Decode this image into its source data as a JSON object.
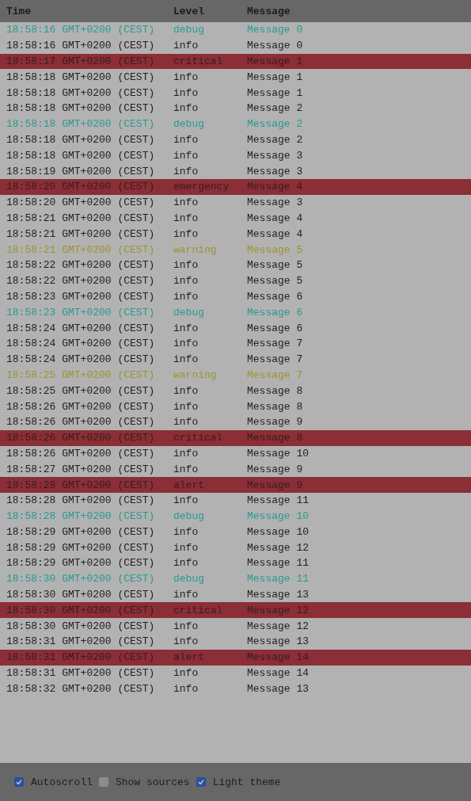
{
  "table": {
    "columns": [
      "Time",
      "Level",
      "Message"
    ],
    "rows": [
      {
        "time": "18:58:16 GMT+0200 (CEST)",
        "level": "debug",
        "message": "Message 0",
        "kind": "debug"
      },
      {
        "time": "18:58:16 GMT+0200 (CEST)",
        "level": "info",
        "message": "Message 0",
        "kind": "info"
      },
      {
        "time": "18:58:17 GMT+0200 (CEST)",
        "level": "critical",
        "message": "Message 1",
        "kind": "error"
      },
      {
        "time": "18:58:18 GMT+0200 (CEST)",
        "level": "info",
        "message": "Message 1",
        "kind": "info"
      },
      {
        "time": "18:58:18 GMT+0200 (CEST)",
        "level": "info",
        "message": "Message 1",
        "kind": "info"
      },
      {
        "time": "18:58:18 GMT+0200 (CEST)",
        "level": "info",
        "message": "Message 2",
        "kind": "info"
      },
      {
        "time": "18:58:18 GMT+0200 (CEST)",
        "level": "debug",
        "message": "Message 2",
        "kind": "debug"
      },
      {
        "time": "18:58:18 GMT+0200 (CEST)",
        "level": "info",
        "message": "Message 2",
        "kind": "info"
      },
      {
        "time": "18:58:18 GMT+0200 (CEST)",
        "level": "info",
        "message": "Message 3",
        "kind": "info"
      },
      {
        "time": "18:58:19 GMT+0200 (CEST)",
        "level": "info",
        "message": "Message 3",
        "kind": "info"
      },
      {
        "time": "18:58:20 GMT+0200 (CEST)",
        "level": "emergency",
        "message": "Message 4",
        "kind": "error"
      },
      {
        "time": "18:58:20 GMT+0200 (CEST)",
        "level": "info",
        "message": "Message 3",
        "kind": "info"
      },
      {
        "time": "18:58:21 GMT+0200 (CEST)",
        "level": "info",
        "message": "Message 4",
        "kind": "info"
      },
      {
        "time": "18:58:21 GMT+0200 (CEST)",
        "level": "info",
        "message": "Message 4",
        "kind": "info"
      },
      {
        "time": "18:58:21 GMT+0200 (CEST)",
        "level": "warning",
        "message": "Message 5",
        "kind": "warning"
      },
      {
        "time": "18:58:22 GMT+0200 (CEST)",
        "level": "info",
        "message": "Message 5",
        "kind": "info"
      },
      {
        "time": "18:58:22 GMT+0200 (CEST)",
        "level": "info",
        "message": "Message 5",
        "kind": "info"
      },
      {
        "time": "18:58:23 GMT+0200 (CEST)",
        "level": "info",
        "message": "Message 6",
        "kind": "info"
      },
      {
        "time": "18:58:23 GMT+0200 (CEST)",
        "level": "debug",
        "message": "Message 6",
        "kind": "debug"
      },
      {
        "time": "18:58:24 GMT+0200 (CEST)",
        "level": "info",
        "message": "Message 6",
        "kind": "info"
      },
      {
        "time": "18:58:24 GMT+0200 (CEST)",
        "level": "info",
        "message": "Message 7",
        "kind": "info"
      },
      {
        "time": "18:58:24 GMT+0200 (CEST)",
        "level": "info",
        "message": "Message 7",
        "kind": "info"
      },
      {
        "time": "18:58:25 GMT+0200 (CEST)",
        "level": "warning",
        "message": "Message 7",
        "kind": "warning"
      },
      {
        "time": "18:58:25 GMT+0200 (CEST)",
        "level": "info",
        "message": "Message 8",
        "kind": "info"
      },
      {
        "time": "18:58:26 GMT+0200 (CEST)",
        "level": "info",
        "message": "Message 8",
        "kind": "info"
      },
      {
        "time": "18:58:26 GMT+0200 (CEST)",
        "level": "info",
        "message": "Message 9",
        "kind": "info"
      },
      {
        "time": "18:58:26 GMT+0200 (CEST)",
        "level": "critical",
        "message": "Message 8",
        "kind": "error"
      },
      {
        "time": "18:58:26 GMT+0200 (CEST)",
        "level": "info",
        "message": "Message 10",
        "kind": "info"
      },
      {
        "time": "18:58:27 GMT+0200 (CEST)",
        "level": "info",
        "message": "Message 9",
        "kind": "info"
      },
      {
        "time": "18:58:28 GMT+0200 (CEST)",
        "level": "alert",
        "message": "Message 9",
        "kind": "error"
      },
      {
        "time": "18:58:28 GMT+0200 (CEST)",
        "level": "info",
        "message": "Message 11",
        "kind": "info"
      },
      {
        "time": "18:58:28 GMT+0200 (CEST)",
        "level": "debug",
        "message": "Message 10",
        "kind": "debug"
      },
      {
        "time": "18:58:29 GMT+0200 (CEST)",
        "level": "info",
        "message": "Message 10",
        "kind": "info"
      },
      {
        "time": "18:58:29 GMT+0200 (CEST)",
        "level": "info",
        "message": "Message 12",
        "kind": "info"
      },
      {
        "time": "18:58:29 GMT+0200 (CEST)",
        "level": "info",
        "message": "Message 11",
        "kind": "info"
      },
      {
        "time": "18:58:30 GMT+0200 (CEST)",
        "level": "debug",
        "message": "Message 11",
        "kind": "debug"
      },
      {
        "time": "18:58:30 GMT+0200 (CEST)",
        "level": "info",
        "message": "Message 13",
        "kind": "info"
      },
      {
        "time": "18:58:30 GMT+0200 (CEST)",
        "level": "critical",
        "message": "Message 12",
        "kind": "error"
      },
      {
        "time": "18:58:30 GMT+0200 (CEST)",
        "level": "info",
        "message": "Message 12",
        "kind": "info"
      },
      {
        "time": "18:58:31 GMT+0200 (CEST)",
        "level": "info",
        "message": "Message 13",
        "kind": "info"
      },
      {
        "time": "18:58:31 GMT+0200 (CEST)",
        "level": "alert",
        "message": "Message 14",
        "kind": "error"
      },
      {
        "time": "18:58:31 GMT+0200 (CEST)",
        "level": "info",
        "message": "Message 14",
        "kind": "info"
      },
      {
        "time": "18:58:32 GMT+0200 (CEST)",
        "level": "info",
        "message": "Message 13",
        "kind": "info"
      }
    ]
  },
  "footer": {
    "options": [
      {
        "label": "Autoscroll",
        "checked": true
      },
      {
        "label": "Show sources",
        "checked": false
      },
      {
        "label": "Light theme",
        "checked": true
      }
    ]
  }
}
